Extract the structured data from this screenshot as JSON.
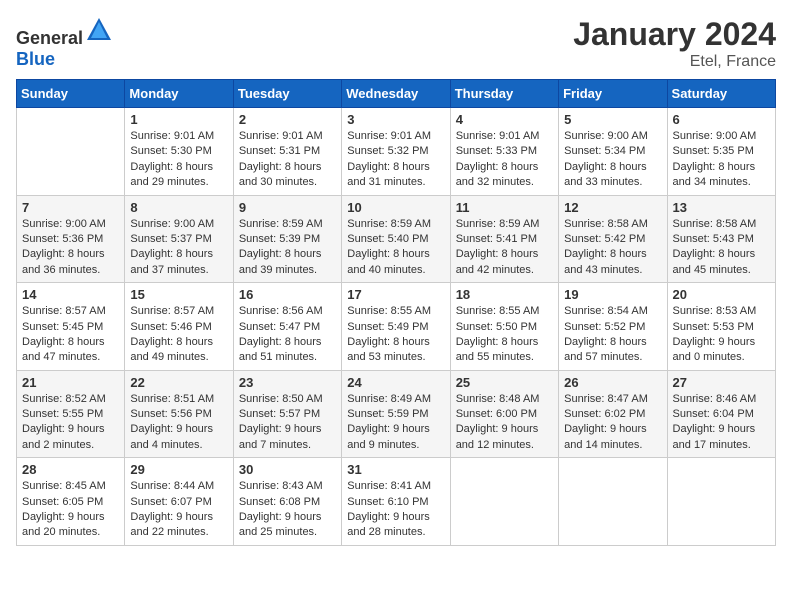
{
  "header": {
    "logo": {
      "general": "General",
      "blue": "Blue"
    },
    "month": "January 2024",
    "location": "Etel, France"
  },
  "weekdays": [
    "Sunday",
    "Monday",
    "Tuesday",
    "Wednesday",
    "Thursday",
    "Friday",
    "Saturday"
  ],
  "weeks": [
    [
      {
        "day": null,
        "sunrise": null,
        "sunset": null,
        "daylight": null
      },
      {
        "day": "1",
        "sunrise": "Sunrise: 9:01 AM",
        "sunset": "Sunset: 5:30 PM",
        "daylight": "Daylight: 8 hours and 29 minutes."
      },
      {
        "day": "2",
        "sunrise": "Sunrise: 9:01 AM",
        "sunset": "Sunset: 5:31 PM",
        "daylight": "Daylight: 8 hours and 30 minutes."
      },
      {
        "day": "3",
        "sunrise": "Sunrise: 9:01 AM",
        "sunset": "Sunset: 5:32 PM",
        "daylight": "Daylight: 8 hours and 31 minutes."
      },
      {
        "day": "4",
        "sunrise": "Sunrise: 9:01 AM",
        "sunset": "Sunset: 5:33 PM",
        "daylight": "Daylight: 8 hours and 32 minutes."
      },
      {
        "day": "5",
        "sunrise": "Sunrise: 9:00 AM",
        "sunset": "Sunset: 5:34 PM",
        "daylight": "Daylight: 8 hours and 33 minutes."
      },
      {
        "day": "6",
        "sunrise": "Sunrise: 9:00 AM",
        "sunset": "Sunset: 5:35 PM",
        "daylight": "Daylight: 8 hours and 34 minutes."
      }
    ],
    [
      {
        "day": "7",
        "sunrise": "Sunrise: 9:00 AM",
        "sunset": "Sunset: 5:36 PM",
        "daylight": "Daylight: 8 hours and 36 minutes."
      },
      {
        "day": "8",
        "sunrise": "Sunrise: 9:00 AM",
        "sunset": "Sunset: 5:37 PM",
        "daylight": "Daylight: 8 hours and 37 minutes."
      },
      {
        "day": "9",
        "sunrise": "Sunrise: 8:59 AM",
        "sunset": "Sunset: 5:39 PM",
        "daylight": "Daylight: 8 hours and 39 minutes."
      },
      {
        "day": "10",
        "sunrise": "Sunrise: 8:59 AM",
        "sunset": "Sunset: 5:40 PM",
        "daylight": "Daylight: 8 hours and 40 minutes."
      },
      {
        "day": "11",
        "sunrise": "Sunrise: 8:59 AM",
        "sunset": "Sunset: 5:41 PM",
        "daylight": "Daylight: 8 hours and 42 minutes."
      },
      {
        "day": "12",
        "sunrise": "Sunrise: 8:58 AM",
        "sunset": "Sunset: 5:42 PM",
        "daylight": "Daylight: 8 hours and 43 minutes."
      },
      {
        "day": "13",
        "sunrise": "Sunrise: 8:58 AM",
        "sunset": "Sunset: 5:43 PM",
        "daylight": "Daylight: 8 hours and 45 minutes."
      }
    ],
    [
      {
        "day": "14",
        "sunrise": "Sunrise: 8:57 AM",
        "sunset": "Sunset: 5:45 PM",
        "daylight": "Daylight: 8 hours and 47 minutes."
      },
      {
        "day": "15",
        "sunrise": "Sunrise: 8:57 AM",
        "sunset": "Sunset: 5:46 PM",
        "daylight": "Daylight: 8 hours and 49 minutes."
      },
      {
        "day": "16",
        "sunrise": "Sunrise: 8:56 AM",
        "sunset": "Sunset: 5:47 PM",
        "daylight": "Daylight: 8 hours and 51 minutes."
      },
      {
        "day": "17",
        "sunrise": "Sunrise: 8:55 AM",
        "sunset": "Sunset: 5:49 PM",
        "daylight": "Daylight: 8 hours and 53 minutes."
      },
      {
        "day": "18",
        "sunrise": "Sunrise: 8:55 AM",
        "sunset": "Sunset: 5:50 PM",
        "daylight": "Daylight: 8 hours and 55 minutes."
      },
      {
        "day": "19",
        "sunrise": "Sunrise: 8:54 AM",
        "sunset": "Sunset: 5:52 PM",
        "daylight": "Daylight: 8 hours and 57 minutes."
      },
      {
        "day": "20",
        "sunrise": "Sunrise: 8:53 AM",
        "sunset": "Sunset: 5:53 PM",
        "daylight": "Daylight: 9 hours and 0 minutes."
      }
    ],
    [
      {
        "day": "21",
        "sunrise": "Sunrise: 8:52 AM",
        "sunset": "Sunset: 5:55 PM",
        "daylight": "Daylight: 9 hours and 2 minutes."
      },
      {
        "day": "22",
        "sunrise": "Sunrise: 8:51 AM",
        "sunset": "Sunset: 5:56 PM",
        "daylight": "Daylight: 9 hours and 4 minutes."
      },
      {
        "day": "23",
        "sunrise": "Sunrise: 8:50 AM",
        "sunset": "Sunset: 5:57 PM",
        "daylight": "Daylight: 9 hours and 7 minutes."
      },
      {
        "day": "24",
        "sunrise": "Sunrise: 8:49 AM",
        "sunset": "Sunset: 5:59 PM",
        "daylight": "Daylight: 9 hours and 9 minutes."
      },
      {
        "day": "25",
        "sunrise": "Sunrise: 8:48 AM",
        "sunset": "Sunset: 6:00 PM",
        "daylight": "Daylight: 9 hours and 12 minutes."
      },
      {
        "day": "26",
        "sunrise": "Sunrise: 8:47 AM",
        "sunset": "Sunset: 6:02 PM",
        "daylight": "Daylight: 9 hours and 14 minutes."
      },
      {
        "day": "27",
        "sunrise": "Sunrise: 8:46 AM",
        "sunset": "Sunset: 6:04 PM",
        "daylight": "Daylight: 9 hours and 17 minutes."
      }
    ],
    [
      {
        "day": "28",
        "sunrise": "Sunrise: 8:45 AM",
        "sunset": "Sunset: 6:05 PM",
        "daylight": "Daylight: 9 hours and 20 minutes."
      },
      {
        "day": "29",
        "sunrise": "Sunrise: 8:44 AM",
        "sunset": "Sunset: 6:07 PM",
        "daylight": "Daylight: 9 hours and 22 minutes."
      },
      {
        "day": "30",
        "sunrise": "Sunrise: 8:43 AM",
        "sunset": "Sunset: 6:08 PM",
        "daylight": "Daylight: 9 hours and 25 minutes."
      },
      {
        "day": "31",
        "sunrise": "Sunrise: 8:41 AM",
        "sunset": "Sunset: 6:10 PM",
        "daylight": "Daylight: 9 hours and 28 minutes."
      },
      {
        "day": null,
        "sunrise": null,
        "sunset": null,
        "daylight": null
      },
      {
        "day": null,
        "sunrise": null,
        "sunset": null,
        "daylight": null
      },
      {
        "day": null,
        "sunrise": null,
        "sunset": null,
        "daylight": null
      }
    ]
  ]
}
